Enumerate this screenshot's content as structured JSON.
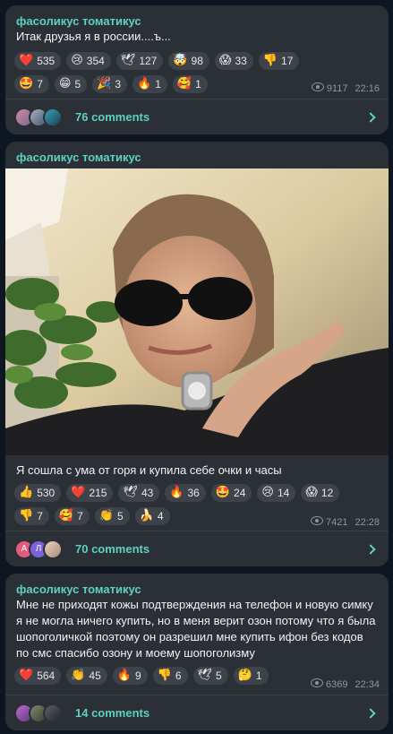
{
  "colors": {
    "accent": "#5fd1c1",
    "bg": "#0e1621",
    "card": "#2b2f36",
    "pill": "#3e434b",
    "meta": "#8f969f"
  },
  "posts": [
    {
      "author": "фасоликус томатикус",
      "text": "Итак друзья я в россии....ъ...",
      "reactions": [
        {
          "emoji": "❤️",
          "count": "535"
        },
        {
          "emoji": "😢",
          "count": "354"
        },
        {
          "emoji": "🕊",
          "count": "127"
        },
        {
          "emoji": "🤯",
          "count": "98"
        },
        {
          "emoji": "😱",
          "count": "33"
        },
        {
          "emoji": "👎",
          "count": "17"
        },
        {
          "emoji": "🤩",
          "count": "7"
        },
        {
          "emoji": "😁",
          "count": "5"
        },
        {
          "emoji": "🎉",
          "count": "3"
        },
        {
          "emoji": "🔥",
          "count": "1"
        },
        {
          "emoji": "🥰",
          "count": "1"
        }
      ],
      "views": "9117",
      "time": "22:16",
      "comments": "76 comments"
    },
    {
      "author": "фасоликус томатикус",
      "text": "Я сошла с ума от горя и купила себе очки и часы",
      "reactions": [
        {
          "emoji": "👍",
          "count": "530"
        },
        {
          "emoji": "❤️",
          "count": "215"
        },
        {
          "emoji": "🕊",
          "count": "43"
        },
        {
          "emoji": "🔥",
          "count": "36"
        },
        {
          "emoji": "🤩",
          "count": "24"
        },
        {
          "emoji": "😢",
          "count": "14"
        },
        {
          "emoji": "😱",
          "count": "12"
        },
        {
          "emoji": "👎",
          "count": "7"
        },
        {
          "emoji": "🥰",
          "count": "7"
        },
        {
          "emoji": "👏",
          "count": "5"
        },
        {
          "emoji": "🍌",
          "count": "4"
        }
      ],
      "views": "7421",
      "time": "22:28",
      "comments": "70 comments",
      "avatar_letters": [
        "А",
        "Л"
      ]
    },
    {
      "author": "фасоликус томатикус",
      "text": "Мне не приходят кожы подтверждения на телефон и новую симку я не могла ничего купить, но в меня верит озон потому что я была шопоголичкой поэтому он разрешил мне купить ифон без кодов по смс спасибо озону и моему шопоголизму",
      "reactions": [
        {
          "emoji": "❤️",
          "count": "564"
        },
        {
          "emoji": "👏",
          "count": "45"
        },
        {
          "emoji": "🔥",
          "count": "9"
        },
        {
          "emoji": "👎",
          "count": "6"
        },
        {
          "emoji": "🕊",
          "count": "5"
        },
        {
          "emoji": "🤔",
          "count": "1"
        }
      ],
      "views": "6369",
      "time": "22:34",
      "comments": "14 comments"
    }
  ]
}
